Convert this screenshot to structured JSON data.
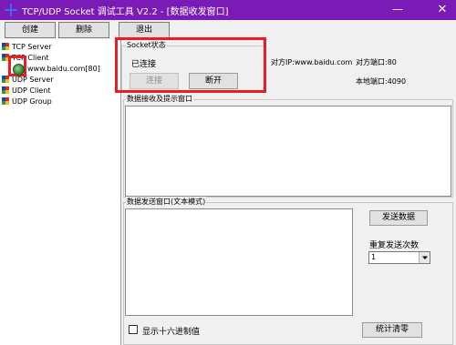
{
  "window": {
    "title": "TCP/UDP Socket 调试工具 V2.2 - [数据收发窗口]",
    "minimize": "—",
    "close": "✕"
  },
  "toolbar": {
    "create": "创建",
    "delete": "删除",
    "exit": "退出"
  },
  "tree": {
    "tcp_server": "TCP Server",
    "tcp_client": "TCP Client",
    "client_conn": "www.baidu.com[80]",
    "udp_server": "UDP Server",
    "udp_client": "UDP Client",
    "udp_group": "UDP Group"
  },
  "socket": {
    "group_title": "Socket状态",
    "status": "已连接",
    "connect_button": "连接",
    "disconnect_button": "断开",
    "remote_ip": "对方IP:www.baidu.com",
    "remote_port": "对方端口:80",
    "local_port": "本地端口:4090"
  },
  "receive": {
    "title": "数据接收及提示窗口"
  },
  "send": {
    "title": "数据发送窗口(文本模式)",
    "send_button": "发送数据",
    "repeat_label": "重复发送次数",
    "repeat_value": "1",
    "hex_label": "显示十六进制值",
    "stats_clear": "统计清零"
  },
  "colors": {
    "titlebar": "#7a1bb8",
    "highlight": "#ec1c24"
  }
}
